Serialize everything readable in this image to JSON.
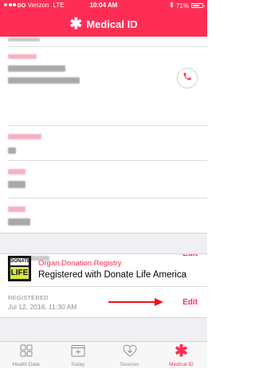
{
  "status_bar": {
    "carrier": "Verizon",
    "network": "LTE",
    "time": "10:04 AM",
    "battery": "71%",
    "battery_level": 0.71
  },
  "nav": {
    "title": "Medical ID",
    "icon": "asterisk-icon"
  },
  "emergency_contact": {
    "call_icon": "phone-icon"
  },
  "updated": {
    "label": "UPDATED",
    "edit_label": "Edit"
  },
  "organ_donation": {
    "logo_top": "DONATE",
    "logo_bottom": "LIFE",
    "registry_name": "Organ Donation Registry",
    "status": "Registered with Donate Life America",
    "registered_label": "REGISTERED",
    "registered_date": "Jul 12, 2016, 11:30 AM",
    "edit_label": "Edit",
    "arrow_color": "#e8141c"
  },
  "tab_bar": {
    "tabs": [
      {
        "label": "Health Data",
        "icon": "health-data-grid-icon"
      },
      {
        "label": "Today",
        "icon": "calendar-icon"
      },
      {
        "label": "Sources",
        "icon": "sources-heart-download-icon"
      },
      {
        "label": "Medical ID",
        "icon": "asterisk-icon",
        "active": true
      }
    ]
  },
  "colors": {
    "accent": "#ff2d55",
    "background_gray": "#efeff4",
    "secondary_text": "#8e8e93"
  }
}
